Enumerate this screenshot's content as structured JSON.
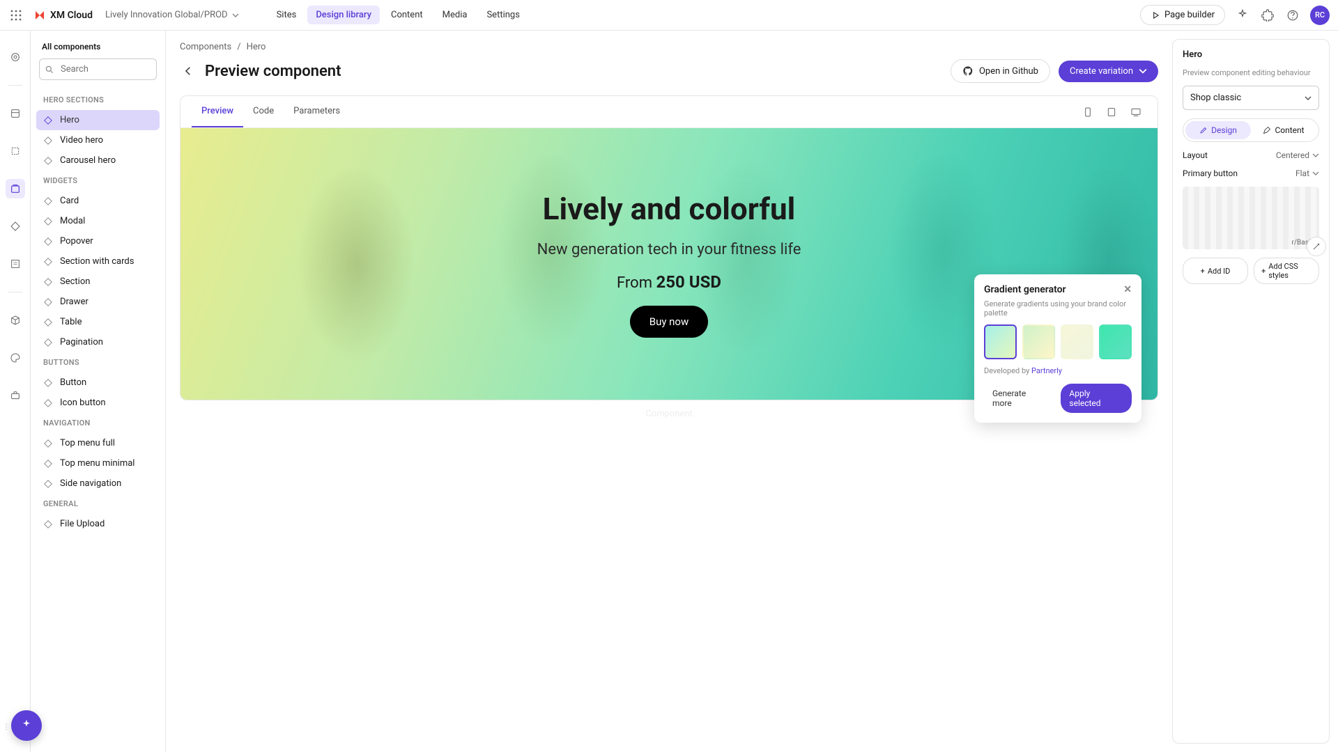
{
  "topbar": {
    "product": "XM Cloud",
    "project": "Lively Innovation Global/PROD",
    "nav": [
      "Sites",
      "Design library",
      "Content",
      "Media",
      "Settings"
    ],
    "nav_active": 1,
    "page_builder": "Page builder",
    "avatar": "RC"
  },
  "sidepanel": {
    "all": "All components",
    "search_placeholder": "Search",
    "sections": [
      {
        "title": "HERO SECTIONS",
        "items": [
          "Hero",
          "Video hero",
          "Carousel hero"
        ],
        "active": 0
      },
      {
        "title": "WIDGETS",
        "items": [
          "Card",
          "Modal",
          "Popover",
          "Section with cards",
          "Section",
          "Drawer",
          "Table",
          "Pagination"
        ]
      },
      {
        "title": "BUTTONS",
        "items": [
          "Button",
          "Icon button"
        ]
      },
      {
        "title": "NAVIGATION",
        "items": [
          "Top menu full",
          "Top menu minimal",
          "Side navigation"
        ]
      },
      {
        "title": "GENERAL",
        "items": [
          "File Upload"
        ]
      }
    ]
  },
  "breadcrumb": [
    "Components",
    "Hero"
  ],
  "page_title": "Preview component",
  "header_actions": {
    "github": "Open in Github",
    "create": "Create variation"
  },
  "preview_tabs": [
    "Preview",
    "Code",
    "Parameters"
  ],
  "hero": {
    "title": "Lively and colorful",
    "subtitle": "New generation tech in your fitness life",
    "price_prefix": "From ",
    "price": "250 USD",
    "cta": "Buy now"
  },
  "component_label": "Component",
  "inspector": {
    "title": "Hero",
    "subtitle": "Preview component editing behaviour",
    "preset": "Shop classic",
    "tabs": [
      "Design",
      "Content"
    ],
    "props": [
      {
        "label": "Layout",
        "value": "Centered"
      },
      {
        "label": "Primary button",
        "value": "Flat"
      }
    ],
    "thumb_caption": "r/Basi…",
    "add_id": "Add ID",
    "add_css": "Add CSS styles"
  },
  "popover": {
    "title": "Gradient generator",
    "subtitle": "Generate gradients using your brand color palette",
    "swatches": [
      "linear-gradient(135deg,#a6f0e8,#e6f7bd)",
      "linear-gradient(135deg,#d0f2c9,#fff6c9)",
      "linear-gradient(135deg,#f7f7d8,#f0f5e0)",
      "linear-gradient(135deg,#3ee6ad,#5de0c0)"
    ],
    "developed_by": "Developed by ",
    "partner": "Partnerly",
    "generate": "Generate more",
    "apply": "Apply selected"
  }
}
